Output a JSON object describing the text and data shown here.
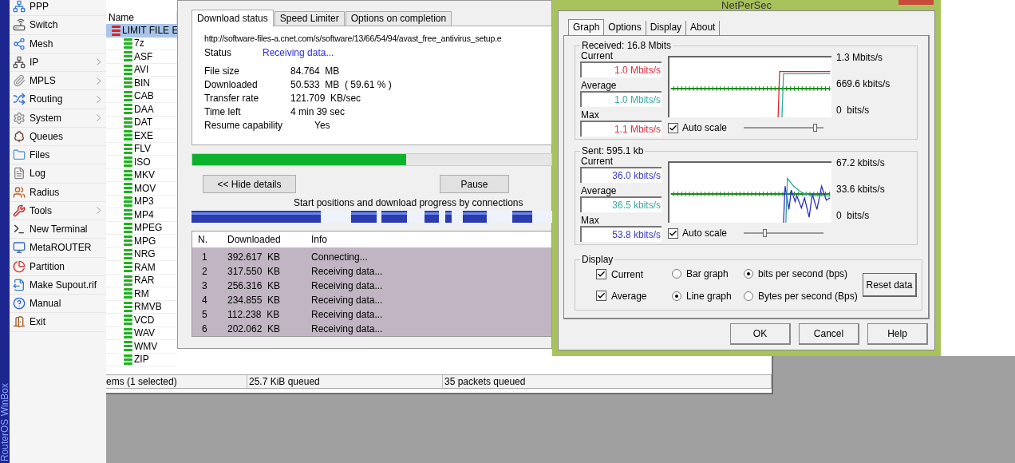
{
  "desktop": {
    "vertical_title": "RouterOS WinBox"
  },
  "sidebar": {
    "items": [
      {
        "label": "PPP",
        "submenu": false
      },
      {
        "label": "Switch",
        "submenu": false
      },
      {
        "label": "Mesh",
        "submenu": false
      },
      {
        "label": "IP",
        "submenu": true
      },
      {
        "label": "MPLS",
        "submenu": true
      },
      {
        "label": "Routing",
        "submenu": true
      },
      {
        "label": "System",
        "submenu": true
      },
      {
        "label": "Queues",
        "submenu": false
      },
      {
        "label": "Files",
        "submenu": false
      },
      {
        "label": "Log",
        "submenu": false
      },
      {
        "label": "Radius",
        "submenu": false
      },
      {
        "label": "Tools",
        "submenu": true
      },
      {
        "label": "New Terminal",
        "submenu": false
      },
      {
        "label": "MetaROUTER",
        "submenu": false
      },
      {
        "label": "Partition",
        "submenu": false
      },
      {
        "label": "Make Supout.rif",
        "submenu": false
      },
      {
        "label": "Manual",
        "submenu": false
      },
      {
        "label": "Exit",
        "submenu": false
      }
    ]
  },
  "queue_window": {
    "column": "Name",
    "tree": [
      {
        "label": "LIMIT FILE E",
        "selected": true,
        "color": "#e02020",
        "children": [
          {
            "label": "7z",
            "selected": false,
            "color": "#20b020"
          },
          {
            "label": "ASF",
            "selected": false,
            "color": "#20b020"
          },
          {
            "label": "AVI",
            "selected": false,
            "color": "#20b020"
          },
          {
            "label": "BIN",
            "selected": false,
            "color": "#20b020"
          },
          {
            "label": "CAB",
            "selected": false,
            "color": "#20b020"
          },
          {
            "label": "DAA",
            "selected": false,
            "color": "#20b020"
          },
          {
            "label": "DAT",
            "selected": false,
            "color": "#20b020"
          },
          {
            "label": "EXE",
            "selected": false,
            "color": "#20b020"
          },
          {
            "label": "FLV",
            "selected": false,
            "color": "#20b020"
          },
          {
            "label": "ISO",
            "selected": false,
            "color": "#20b020"
          },
          {
            "label": "MKV",
            "selected": false,
            "color": "#20b020"
          },
          {
            "label": "MOV",
            "selected": false,
            "color": "#20b020"
          },
          {
            "label": "MP3",
            "selected": false,
            "color": "#20b020"
          },
          {
            "label": "MP4",
            "selected": false,
            "color": "#20b020"
          },
          {
            "label": "MPEG",
            "selected": false,
            "color": "#20b020"
          },
          {
            "label": "MPG",
            "selected": false,
            "color": "#20b020"
          },
          {
            "label": "NRG",
            "selected": false,
            "color": "#20b020"
          },
          {
            "label": "RAM",
            "selected": false,
            "color": "#20b020"
          },
          {
            "label": "RAR",
            "selected": false,
            "color": "#20b020"
          },
          {
            "label": "RM",
            "selected": false,
            "color": "#20b020"
          },
          {
            "label": "RMVB",
            "selected": false,
            "color": "#20b020"
          },
          {
            "label": "VCD",
            "selected": false,
            "color": "#20b020"
          },
          {
            "label": "WAV",
            "selected": false,
            "color": "#20b020"
          },
          {
            "label": "WMV",
            "selected": false,
            "color": "#20b020"
          },
          {
            "label": "ZIP",
            "selected": false,
            "color": "#20b020"
          }
        ]
      }
    ],
    "status_bar": [
      "ems (1 selected)",
      "25.7 KiB queued",
      "35 packets queued"
    ]
  },
  "download_dialog": {
    "tabs": [
      {
        "label": "Download status",
        "selected": true
      },
      {
        "label": "Speed Limiter",
        "selected": false
      },
      {
        "label": "Options on completion",
        "selected": false
      }
    ],
    "url": "http://software-files-a.cnet.com/s/software/13/66/54/94/avast_free_antivirus_setup.e",
    "status": {
      "label": "Status",
      "value": "Receiving data..."
    },
    "fields": [
      {
        "label": "File size",
        "value": "84.764  MB"
      },
      {
        "label": "Downloaded",
        "value": "50.533  MB  ( 59.61 % )"
      },
      {
        "label": "Transfer rate",
        "value": "121.709  KB/sec"
      },
      {
        "label": "Time left",
        "value": "4 min 39 sec"
      },
      {
        "label": "Resume capability",
        "value": "Yes"
      }
    ],
    "progress": {
      "level": 0.5961
    },
    "buttons": [
      "<< Hide details",
      "Pause"
    ],
    "connections_caption": "Start positions and download progress by connections",
    "table": {
      "columns": [
        "N.",
        "Downloaded",
        "Info"
      ],
      "rows": [
        [
          "1",
          "392.617  KB",
          "Connecting..."
        ],
        [
          "2",
          "317.550  KB",
          "Receiving data..."
        ],
        [
          "3",
          "256.316  KB",
          "Receiving data..."
        ],
        [
          "4",
          "234.855  KB",
          "Receiving data..."
        ],
        [
          "5",
          "112.238  KB",
          "Receiving data..."
        ],
        [
          "6",
          "202.062  KB",
          "Receiving data..."
        ]
      ]
    }
  },
  "netpersec": {
    "title": "NetPerSec",
    "tabs": [
      {
        "label": "Graph",
        "selected": true
      },
      {
        "label": "Options",
        "selected": false
      },
      {
        "label": "Display",
        "selected": false
      },
      {
        "label": "About",
        "selected": false
      }
    ],
    "groups": [
      {
        "title": "Received: 16.8 Mbits",
        "stats": [
          {
            "label": "Current",
            "value": "1.0 Mbits/s",
            "color": "#e8283c"
          },
          {
            "label": "Average",
            "value": "1.0 Mbits/s",
            "color": "#3aa8a0"
          },
          {
            "label": "Max",
            "value": "1.1 Mbits/s",
            "color": "#e8283c"
          }
        ],
        "ticks": [
          "1.3 Mbits/s",
          "669.6 kbits/s",
          "0  bits/s"
        ],
        "auto_scale": {
          "label": "Auto scale",
          "checked": true
        },
        "slider": {
          "level": 0.9
        }
      },
      {
        "title": "Sent: 595.1 kb",
        "stats": [
          {
            "label": "Current",
            "value": "36.0 kbits/s",
            "color": "#3838d0"
          },
          {
            "label": "Average",
            "value": "36.5 kbits/s",
            "color": "#3aa8a0"
          },
          {
            "label": "Max",
            "value": "53.8 kbits/s",
            "color": "#3838d0"
          }
        ],
        "ticks": [
          "67.2 kbits/s",
          "33.6 kbits/s",
          "0  bits/s"
        ],
        "auto_scale": {
          "label": "Auto scale",
          "checked": true
        },
        "slider": {
          "level": 0.27
        }
      }
    ],
    "display": {
      "title": "Display",
      "checks": [
        {
          "label": "Current",
          "checked": true
        },
        {
          "label": "Average",
          "checked": true
        }
      ],
      "graph_types": [
        {
          "label": "Bar graph",
          "selected": false
        },
        {
          "label": "Line graph",
          "selected": true
        }
      ],
      "units": [
        {
          "label": "bits per second (bps)",
          "selected": true
        },
        {
          "label": "Bytes per second (Bps)",
          "selected": false
        }
      ],
      "reset": "Reset data"
    },
    "buttons": [
      "OK",
      "Cancel",
      "Help"
    ]
  }
}
